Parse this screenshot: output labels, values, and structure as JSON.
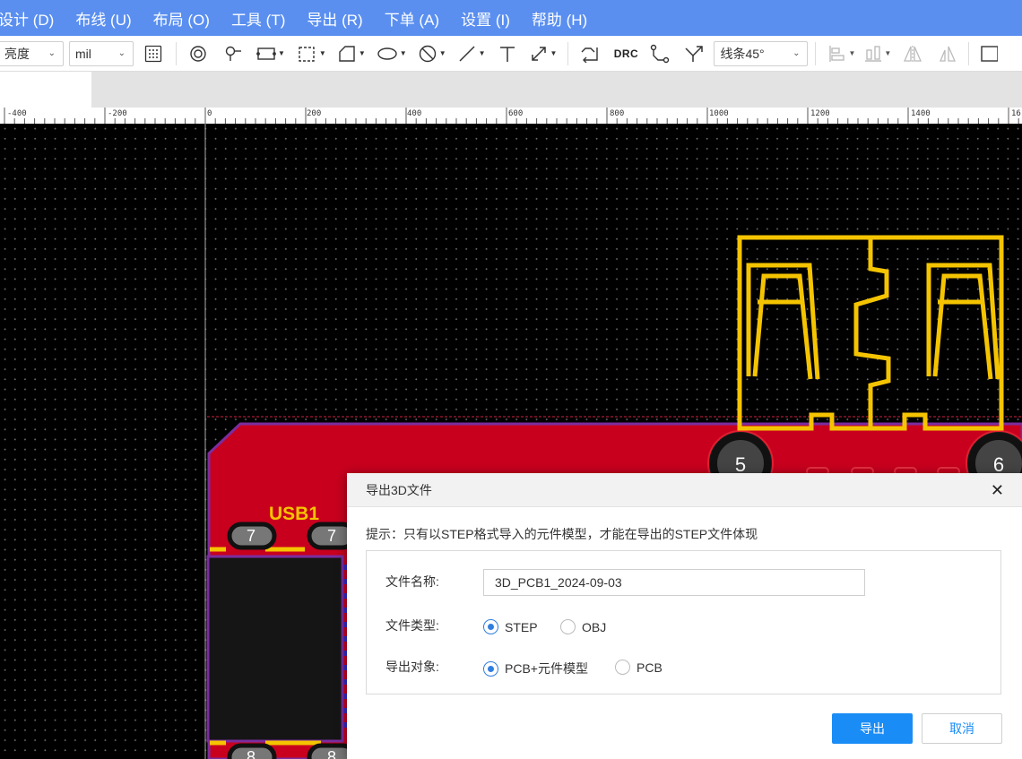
{
  "menu": [
    "设计 (D)",
    "布线 (U)",
    "布局 (O)",
    "工具 (T)",
    "导出 (R)",
    "下单 (A)",
    "设置 (I)",
    "帮助 (H)"
  ],
  "toolbar": {
    "brightness_select": "亮度",
    "unit_select": "mil",
    "route_mode_select": "线条45°",
    "drc_label": "DRC"
  },
  "ruler": {
    "labels": [
      "-400",
      "-200",
      "0",
      "200",
      "400",
      "600",
      "800",
      "1000",
      "1200",
      "1400",
      "16"
    ]
  },
  "board": {
    "component_label": "USB1",
    "pads": [
      "7",
      "7",
      "8",
      "8"
    ],
    "holes": [
      "5",
      "6"
    ]
  },
  "dialog": {
    "title": "导出3D文件",
    "hint": "提示：只有以STEP格式导入的元件模型，才能在导出的STEP文件体现",
    "file_name_label": "文件名称:",
    "file_name_value": "3D_PCB1_2024-09-03",
    "file_type_label": "文件类型:",
    "file_type_options": [
      "STEP",
      "OBJ"
    ],
    "file_type_selected": "STEP",
    "export_target_label": "导出对象:",
    "export_target_options": [
      "PCB+元件模型",
      "PCB"
    ],
    "export_target_selected": "PCB+元件模型",
    "export_button": "导出",
    "cancel_button": "取消"
  },
  "colors": {
    "menubar": "#5a8ff0",
    "board": "#c8001e",
    "silkscreen": "#f5c400",
    "outline": "#7b2d9e",
    "primary_button": "#1a8cf5"
  }
}
